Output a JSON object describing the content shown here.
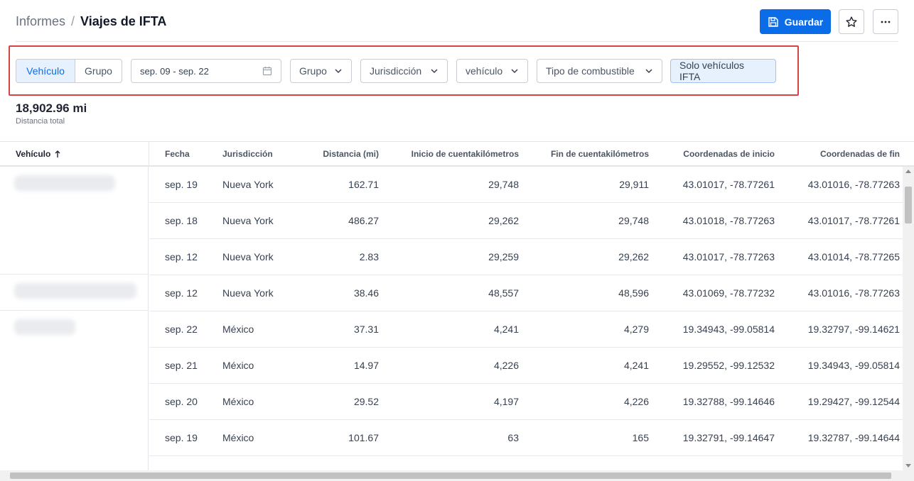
{
  "header": {
    "breadcrumb_parent": "Informes",
    "breadcrumb_separator": "/",
    "title": "Viajes de IFTA",
    "save_label": "Guardar",
    "save_icon": "save-icon",
    "star_icon": "star-icon",
    "more_icon": "more-horizontal-icon"
  },
  "filters": {
    "segment": {
      "options": [
        "Vehículo",
        "Grupo"
      ],
      "selected": "Vehículo"
    },
    "date_range": "sep. 09 - sep. 22",
    "date_icon": "calendar-icon",
    "group": "Grupo",
    "jurisdiction": "Jurisdicción",
    "vehicle": "vehículo",
    "fuel_type": "Tipo de combustible",
    "ifta_only": "Solo vehículos IFTA",
    "highlight_color": "#d64545"
  },
  "summary": {
    "total_value": "18,902.96 mi",
    "total_label": "Distancia total"
  },
  "table": {
    "sort_icon": "arrow-up-icon",
    "columns": [
      "Vehículo",
      "Fecha",
      "Jurisdicción",
      "Distancia (mi)",
      "Inicio de cuentakilómetros",
      "Fin de cuentakilómetros",
      "Coordenadas de inicio",
      "Coordenadas de fin"
    ],
    "rows": [
      [
        "sep. 19",
        "Nueva York",
        "162.71",
        "29,748",
        "29,911",
        "43.01017, -78.77261",
        "43.01016, -78.77263"
      ],
      [
        "sep. 18",
        "Nueva York",
        "486.27",
        "29,262",
        "29,748",
        "43.01018, -78.77263",
        "43.01017, -78.77261"
      ],
      [
        "sep. 12",
        "Nueva York",
        "2.83",
        "29,259",
        "29,262",
        "43.01017, -78.77263",
        "43.01014, -78.77265"
      ],
      [
        "sep. 12",
        "Nueva York",
        "38.46",
        "48,557",
        "48,596",
        "43.01069, -78.77232",
        "43.01016, -78.77263"
      ],
      [
        "sep. 22",
        "México",
        "37.31",
        "4,241",
        "4,279",
        "19.34943, -99.05814",
        "19.32797, -99.14621"
      ],
      [
        "sep. 21",
        "México",
        "14.97",
        "4,226",
        "4,241",
        "19.29552, -99.12532",
        "19.34943, -99.05814"
      ],
      [
        "sep. 20",
        "México",
        "29.52",
        "4,197",
        "4,226",
        "19.32788, -99.14646",
        "19.29427, -99.12544"
      ],
      [
        "sep. 19",
        "México",
        "101.67",
        "63",
        "165",
        "19.32791, -99.14647",
        "19.32787, -99.14644"
      ]
    ]
  },
  "colors": {
    "accent": "#0b6ce8",
    "accent_light": "#e7f1fd"
  }
}
